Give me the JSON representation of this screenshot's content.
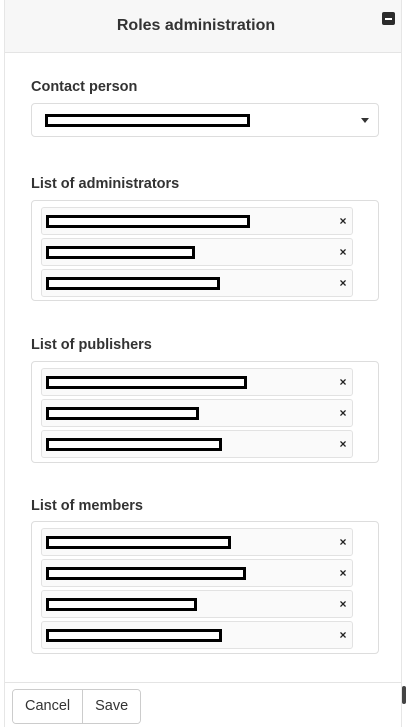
{
  "dialog": {
    "title": "Roles administration",
    "minimize_icon": "minus-square-icon"
  },
  "contact": {
    "label": "Contact person",
    "caret_icon": "caret-down-icon"
  },
  "administrators": {
    "label": "List of administrators",
    "remove_glyph": "×",
    "items": 3
  },
  "publishers": {
    "label": "List of publishers",
    "remove_glyph": "×",
    "items": 3
  },
  "members": {
    "label": "List of members",
    "remove_glyph": "×",
    "items": 4
  },
  "footer": {
    "cancel_label": "Cancel",
    "save_label": "Save"
  },
  "colors": {
    "header_bg": "#f7f7f7",
    "border": "#dddddd",
    "redaction": "#000000"
  }
}
